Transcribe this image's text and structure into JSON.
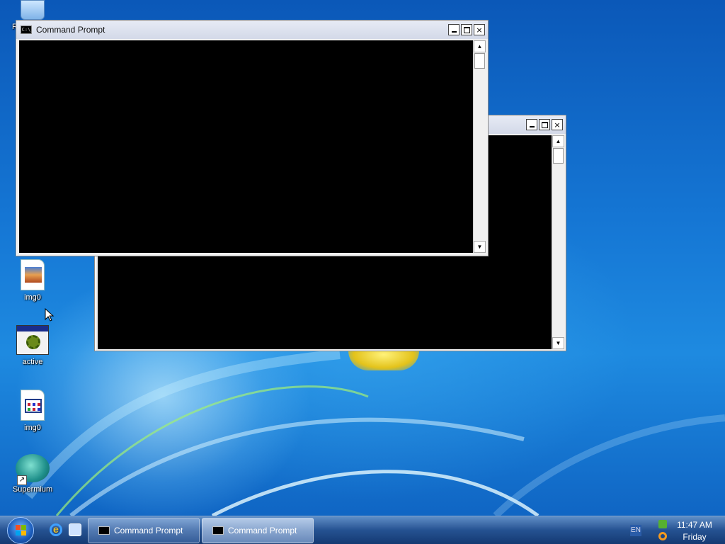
{
  "desktop": {
    "icons": [
      {
        "label": "img0",
        "kind": "image-file"
      },
      {
        "label": "active",
        "kind": "application"
      },
      {
        "label": "img0",
        "kind": "window-file"
      },
      {
        "label": "Supermium",
        "kind": "shortcut"
      }
    ],
    "partial_icon_label": "R"
  },
  "windows": {
    "front": {
      "title": "Command Prompt",
      "icon": "cmd-icon"
    },
    "back": {
      "title": "",
      "icon": "cmd-icon"
    },
    "controls": {
      "minimize": "minimize-icon",
      "maximize": "maximize-icon",
      "close": "×"
    },
    "scroll_up": "▲",
    "scroll_down": "▼"
  },
  "taskbar": {
    "start": "start-orb",
    "quick_launch": [
      "internet-explorer-icon",
      "switch-windows-icon"
    ],
    "tasks": [
      {
        "label": "Command Prompt"
      },
      {
        "label": "Command Prompt"
      }
    ],
    "language": "EN",
    "clock": {
      "time": "11:47 AM",
      "day": "Friday"
    }
  },
  "colors": {
    "console_bg": "#000000",
    "desktop_blue": "#1576d4"
  }
}
